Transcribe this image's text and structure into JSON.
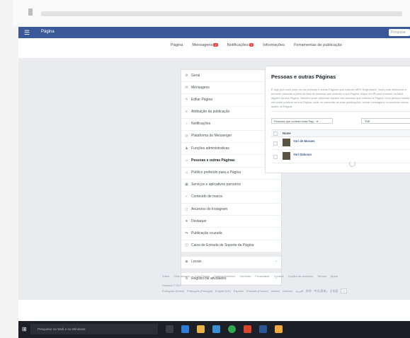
{
  "header": {
    "title": "Página",
    "search_placeholder": "Pesquisa"
  },
  "topnav": [
    {
      "label": "Página"
    },
    {
      "label": "Mensagens",
      "badge": "2"
    },
    {
      "label": "Notificações",
      "badge": "9"
    },
    {
      "label": "Informações"
    },
    {
      "label": "Ferramentas de publicação"
    }
  ],
  "left_menu": [
    {
      "icon": "gear-icon",
      "glyph": "⚙",
      "label": "Geral"
    },
    {
      "icon": "message-icon",
      "glyph": "✉",
      "label": "Mensagens"
    },
    {
      "icon": "edit-icon",
      "glyph": "✎",
      "label": "Editar Página"
    },
    {
      "icon": "attribution-icon",
      "glyph": "≡",
      "label": "Atribuição da publicação"
    },
    {
      "icon": "bell-icon",
      "glyph": "♪",
      "label": "Notificações"
    },
    {
      "icon": "messenger-icon",
      "glyph": "◎",
      "label": "Plataforma do Messenger"
    },
    {
      "icon": "admin-icon",
      "glyph": "♟",
      "label": "Funções administrativas"
    },
    {
      "icon": "people-icon",
      "glyph": "☺",
      "label": "Pessoas e outras Páginas",
      "active": true
    },
    {
      "icon": "audience-icon",
      "glyph": "☺",
      "label": "Público preferido para a Página"
    },
    {
      "icon": "apps-icon",
      "glyph": "▣",
      "label": "Serviços e aplicativos parceiros"
    },
    {
      "icon": "branded-icon",
      "glyph": "✓",
      "label": "Conteúdo de marca"
    },
    {
      "icon": "instagram-icon",
      "glyph": "◻",
      "label": "Anúncios do Instagram"
    },
    {
      "icon": "star-icon",
      "glyph": "★",
      "label": "Destaque"
    },
    {
      "icon": "crosspost-icon",
      "glyph": "⇆",
      "label": "Publicação cruzada"
    },
    {
      "icon": "inbox-icon",
      "glyph": "◫",
      "label": "Caixa de Entrada de Suporte da Página"
    },
    {
      "icon": "locale-icon",
      "glyph": "◉",
      "label": "Locais",
      "plus": true,
      "gap_before": true
    },
    {
      "icon": "log-icon",
      "glyph": "≣",
      "label": "Registro de atividades",
      "plus": true,
      "gap_before": true
    }
  ],
  "panel": {
    "title": "Pessoas e outras Páginas",
    "description": "É aqui que você pode ver as pessoas e outras Páginas que curtiram MRV Engenharia. Você pode selecionar e remover pessoas a partir da lista de pessoas que curtiram a sua Página, clique em ⚙ para remover ou banir alguém da sua Página. Também pode adicionar alguém das pessoas que curtiram a Página. Uma pessoa banida não pode publicar na sua Página, curtir ou comentar as suas publicações, enviar mensagens ou executar outras ações na Página.",
    "dropdown_value": "Pessoas que curtiram esta Pág... ▾",
    "search_value": "Yuri",
    "column_header": "Nome",
    "rows": [
      {
        "name": "Yuri de Moraes"
      },
      {
        "name": "Yuri Dalsson"
      }
    ]
  },
  "footer": {
    "links": [
      "Sobre",
      "Criar anúncio",
      "Criar Página",
      "Desenvolvedores",
      "Carreiras",
      "Privacidade",
      "Cookies",
      "Opções de anúncios",
      "Termos",
      "Ajuda"
    ],
    "copyright": "Facebook © 2017",
    "languages": [
      "Português (Brasil)",
      "Português (Portugal)",
      "English (US)",
      "Español",
      "Français (France)",
      "Italiano",
      "Deutsch",
      "العربية",
      "हिन्दी",
      "中文(简体)",
      "日本語"
    ],
    "more_languages": "+"
  },
  "taskbar": {
    "search_placeholder": "Pesquisar na Web e no Windows"
  },
  "colors": {
    "facebook_blue": "#3b5998",
    "badge_red": "#fa3e3e",
    "link_blue": "#365899"
  }
}
